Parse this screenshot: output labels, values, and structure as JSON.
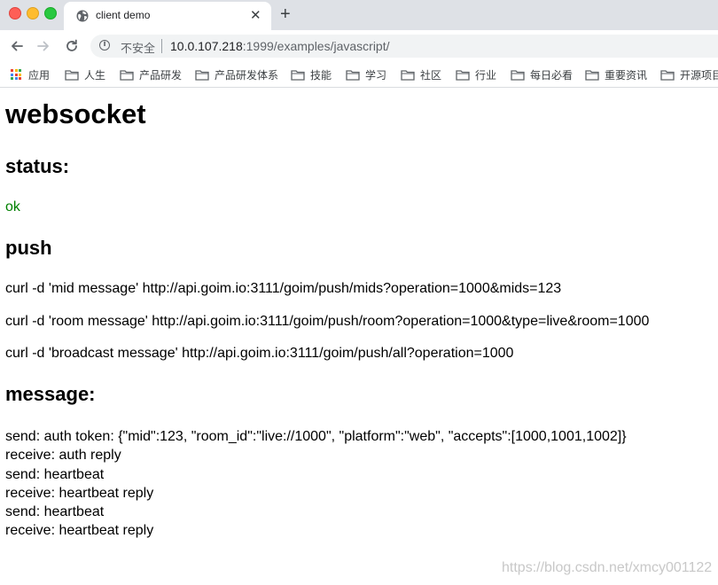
{
  "browser": {
    "tab_title": "client demo",
    "tab_close_glyph": "✕",
    "new_tab_glyph": "+",
    "address": {
      "security_label": "不安全",
      "url_host": "10.0.107.218",
      "url_rest": ":1999/examples/javascript/"
    },
    "bookmarks": {
      "apps_label": "应用",
      "folders": [
        "人生",
        "产品研发",
        "产品研发体系",
        "技能",
        "学习",
        "社区",
        "行业",
        "每日必看",
        "重要资讯",
        "开源项目"
      ]
    }
  },
  "page": {
    "title": "websocket",
    "status_heading": "status:",
    "status_value": "ok",
    "push_heading": "push",
    "push_commands": [
      "curl -d 'mid message' http://api.goim.io:3111/goim/push/mids?operation=1000&mids=123",
      "curl -d 'room message' http://api.goim.io:3111/goim/push/room?operation=1000&type=live&room=1000",
      "curl -d 'broadcast message' http://api.goim.io:3111/goim/push/all?operation=1000"
    ],
    "message_heading": "message:",
    "messages": [
      "send: auth token: {\"mid\":123, \"room_id\":\"live://1000\", \"platform\":\"web\", \"accepts\":[1000,1001,1002]}",
      "receive: auth reply",
      "send: heartbeat",
      "receive: heartbeat reply",
      "send: heartbeat",
      "receive: heartbeat reply"
    ]
  },
  "watermark": "https://blog.csdn.net/xmcy001122",
  "colors": {
    "status_ok": "#008000",
    "tabstrip_bg": "#dee1e6",
    "omnibox_bg": "#f1f3f4"
  }
}
